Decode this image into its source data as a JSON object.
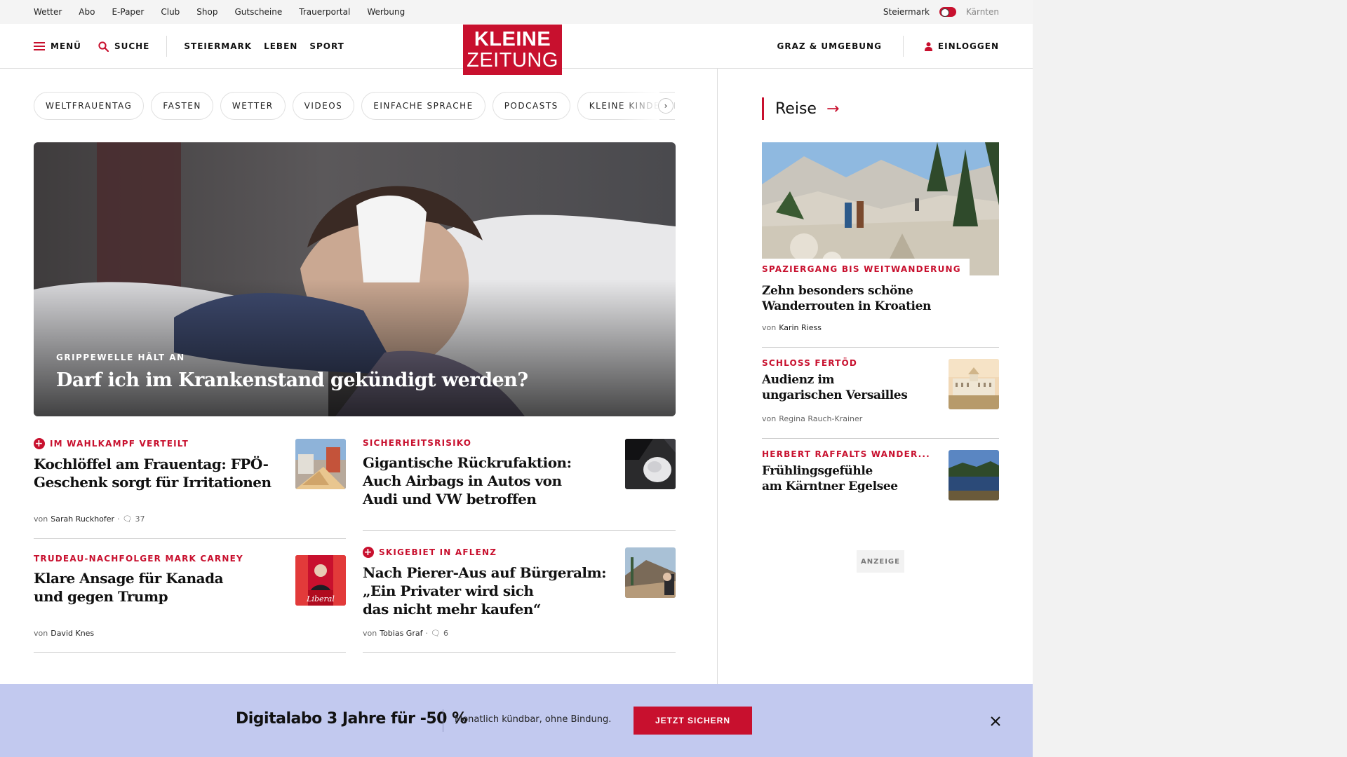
{
  "utility_links": [
    "Wetter",
    "Abo",
    "E-Paper",
    "Club",
    "Shop",
    "Gutscheine",
    "Trauerportal",
    "Werbung"
  ],
  "region": {
    "left": "Steiermark",
    "right": "Kärnten"
  },
  "nav": {
    "menu_label": "MENÜ",
    "search_label": "SUCHE",
    "sections": [
      "STEIERMARK",
      "LEBEN",
      "SPORT"
    ],
    "location": "GRAZ & UMGEBUNG",
    "login_label": "EINLOGGEN"
  },
  "logo": {
    "line1": "KLEINE",
    "line2": "ZEITUNG"
  },
  "chips": [
    "WELTFRAUENTAG",
    "FASTEN",
    "WETTER",
    "VIDEOS",
    "EINFACHE SPRACHE",
    "PODCASTS",
    "KLEINE KINDERZEITUNG"
  ],
  "hero": {
    "kicker": "GRIPPEWELLE HÄLT AN",
    "title": "Darf ich im Krankenstand gekündigt werden?"
  },
  "articles": [
    {
      "kicker": "IM WAHLKAMPF VERTEILT",
      "premium": true,
      "title_lines": [
        "Kochlöffel am Frauentag: FPÖ-",
        "Geschenk sorgt für Irritationen"
      ],
      "by": "von",
      "author": "Sarah Ruckhofer",
      "comments": "37"
    },
    {
      "kicker": "SICHERHEITSRISIKO",
      "premium": false,
      "title_lines": [
        "Gigantische Rückrufaktion:",
        "Auch Airbags in Autos von",
        "Audi und VW betroffen"
      ]
    },
    {
      "kicker": "TRUDEAU-NACHFOLGER MARK CARNEY",
      "premium": false,
      "title_lines": [
        "Klare Ansage für Kanada",
        "und gegen Trump"
      ],
      "by": "von",
      "author": "David Knes"
    },
    {
      "kicker": "SKIGEBIET IN AFLENZ",
      "premium": true,
      "title_lines": [
        "Nach Pierer-Aus auf Bürgeralm:",
        "„Ein Privater wird sich",
        "das nicht mehr kaufen“"
      ],
      "by": "von",
      "author": "Tobias Graf",
      "comments": "6"
    }
  ],
  "thumb_texts": {
    "liberal": "Liberal"
  },
  "sidebar": {
    "section_title": "Reise",
    "feature": {
      "kicker": "SPAZIERGANG BIS WEITWANDERUNG",
      "title_lines": [
        "Zehn besonders schöne",
        "Wanderrouten in Kroatien"
      ],
      "by": "von",
      "author": "Karin Riess"
    },
    "items": [
      {
        "kicker": "SCHLOSS FERTÖD",
        "title_lines": [
          "Audienz im",
          "ungarischen Versailles"
        ],
        "by": "von",
        "author": "Regina Rauch-Krainer"
      },
      {
        "kicker": "HERBERT RAFFALTS WANDER...",
        "title_lines": [
          "Frühlingsgefühle",
          "am Kärntner Egelsee"
        ]
      }
    ],
    "ad_label": "ANZEIGE"
  },
  "promo": {
    "title": "Digitalabo 3 Jahre für -50 %",
    "subtitle": "Monatlich kündbar, ohne Bindung.",
    "button": "JETZT SICHERN"
  },
  "colors": {
    "brand_red": "#c8102e",
    "promo_bg": "#c2c9ef"
  }
}
